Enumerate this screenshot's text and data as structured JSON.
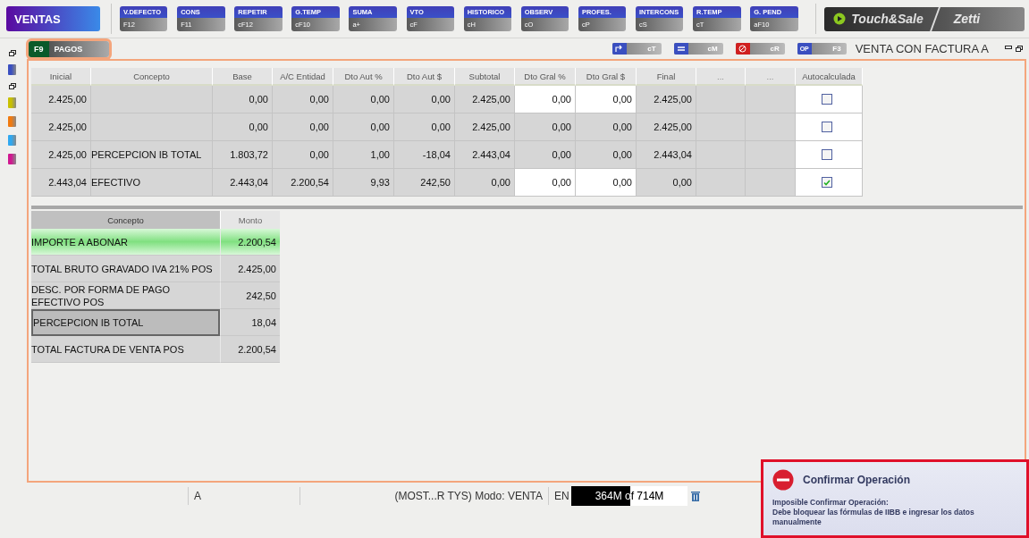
{
  "toolbar": {
    "module": "VENTAS",
    "buttons": [
      {
        "label": "V.DEFECTO",
        "key": "F12"
      },
      {
        "label": "CONS",
        "key": "F11"
      },
      {
        "label": "REPETIR",
        "key": "cF12"
      },
      {
        "label": "G.TEMP",
        "key": "cF10"
      },
      {
        "label": "SUMA",
        "key": "a+"
      },
      {
        "label": "VTO",
        "key": "cF"
      },
      {
        "label": "HISTORICO",
        "key": "cH"
      },
      {
        "label": "OBSERV",
        "key": "cO"
      },
      {
        "label": "PROFES.",
        "key": "cP"
      },
      {
        "label": "INTERCONS",
        "key": "cS"
      },
      {
        "label": "R.TEMP",
        "key": "cT"
      },
      {
        "label": "G. PEND",
        "key": "aF10"
      }
    ],
    "logo": {
      "brand": "Touch&Sale",
      "partner": "Zetti"
    }
  },
  "tab": {
    "key": "F9",
    "label": "PAGOS",
    "selected": true
  },
  "actions": [
    {
      "kind": "swap",
      "key": "cT"
    },
    {
      "kind": "list",
      "key": "cM"
    },
    {
      "kind": "cancel",
      "key": "cR"
    },
    {
      "kind": "op",
      "badge": "OP",
      "key": "F3"
    }
  ],
  "doc_type": "VENTA CON FACTURA A",
  "payments": {
    "columns": [
      "Inicial",
      "Concepto",
      "Base",
      "A/C Entidad",
      "Dto Aut %",
      "Dto Aut $",
      "Subtotal",
      "Dto Gral %",
      "Dto Gral $",
      "Final",
      "...",
      "...",
      "Autocalculada"
    ],
    "rows": [
      {
        "inicial": "2.425,00",
        "values": [
          "0,00",
          "0,00",
          "0,00",
          "0,00",
          "2.425,00",
          "0,00",
          "0,00",
          "2.425,00"
        ],
        "editable": true,
        "checked": false
      },
      {
        "inicial": "2.425,00",
        "values": [
          "0,00",
          "0,00",
          "0,00",
          "0,00",
          "2.425,00",
          "0,00",
          "0,00",
          "2.425,00"
        ],
        "editable": false,
        "checked": false
      },
      {
        "inicial": "2.425,00",
        "concepto": "PERCEPCION IB TOTAL",
        "values": [
          "1.803,72",
          "0,00",
          "1,00",
          "-18,04",
          "2.443,04",
          "0,00",
          "0,00",
          "2.443,04"
        ],
        "editable": false,
        "checked": false
      },
      {
        "inicial": "2.443,04",
        "concepto": "EFECTIVO",
        "values": [
          "2.443,04",
          "2.200,54",
          "9,93",
          "242,50",
          "0,00",
          "0,00",
          "0,00",
          "0,00"
        ],
        "editable": true,
        "checked": true
      }
    ]
  },
  "summary": {
    "columns": [
      "Concepto",
      "Monto"
    ],
    "rows": [
      {
        "concepto": "IMPORTE A ABONAR",
        "monto": "2.200,54",
        "highlighted": true,
        "selected": false
      },
      {
        "concepto": "TOTAL BRUTO GRAVADO IVA 21% POS",
        "monto": "2.425,00",
        "highlighted": false,
        "selected": false
      },
      {
        "concepto": "DESC. POR FORMA DE PAGO EFECTIVO POS",
        "monto": "242,50",
        "highlighted": false,
        "selected": false
      },
      {
        "concepto": "PERCEPCION IB TOTAL",
        "monto": "18,04",
        "highlighted": false,
        "selected": true
      },
      {
        "concepto": "TOTAL FACTURA DE VENTA POS",
        "monto": "2.200,54",
        "highlighted": false,
        "selected": false
      }
    ]
  },
  "status_bar": {
    "field_1": "A",
    "session": "(MOST...R TYS) Modo: VENTA",
    "lang": "EN",
    "memory": {
      "text": "364M of 714M",
      "level": 0.51
    }
  },
  "notification": {
    "title": "Confirmar Operación",
    "message_title": "Imposible Confirmar Operación:",
    "message": "Debe bloquear las fórmulas de IIBB e ingresar los datos manualmente"
  }
}
